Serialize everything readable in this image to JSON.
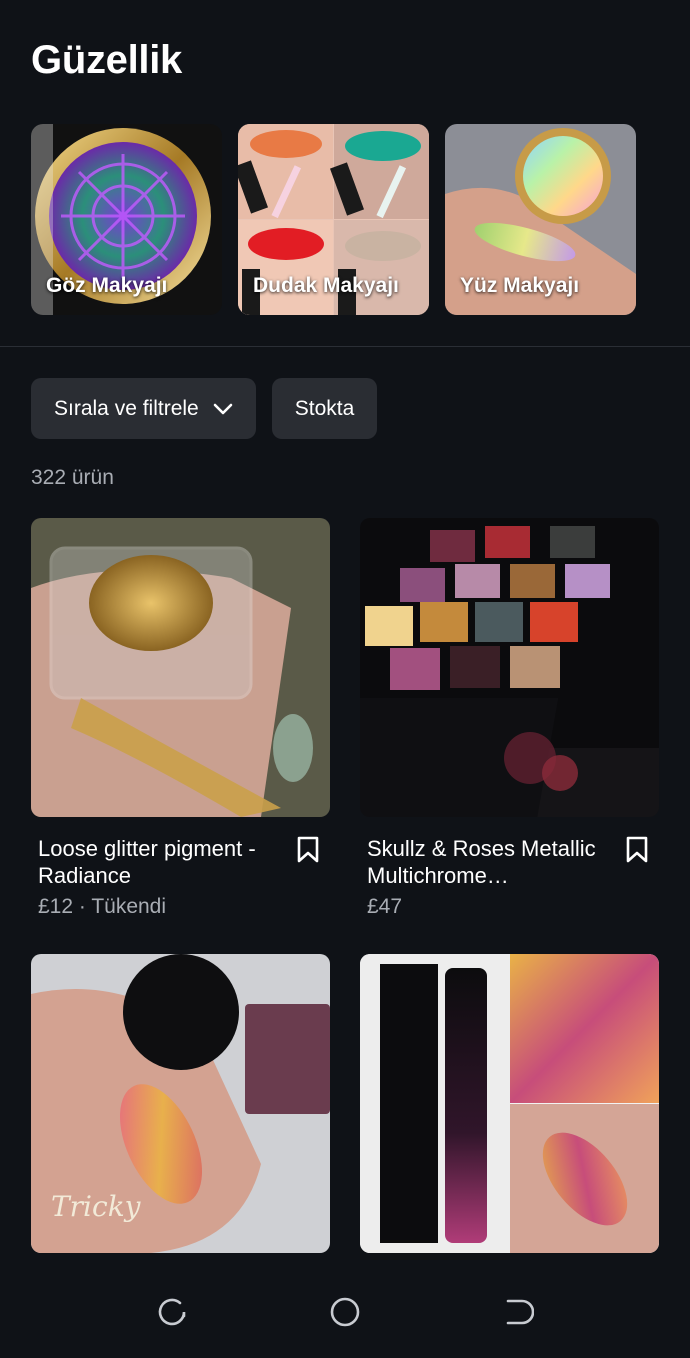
{
  "page": {
    "title": "Güzellik"
  },
  "categories": [
    {
      "label": "Göz Makyajı"
    },
    {
      "label": "Dudak Makyajı"
    },
    {
      "label": "Yüz Makyajı"
    }
  ],
  "filters": {
    "sort_label": "Sırala ve filtrele",
    "stock_label": "Stokta"
  },
  "results": {
    "count_label": "322 ürün"
  },
  "products": [
    {
      "name": "Loose glitter pigment - Radiance",
      "price": "£12",
      "status": "Tükendi",
      "meta": "£12 · Tükendi"
    },
    {
      "name": "Skullz & Roses Metallic Multichrome…",
      "price": "£47",
      "meta": "£47"
    },
    {
      "name": "",
      "meta": "",
      "image_text": "Tricky"
    },
    {
      "name": "",
      "meta": ""
    }
  ],
  "colors": {
    "background": "#0f1217",
    "chip": "#2a2d33",
    "muted_text": "#a9adb4"
  },
  "icons": [
    "chevron-down-icon",
    "bookmark-icon",
    "recent-apps-icon",
    "home-icon",
    "back-icon"
  ]
}
